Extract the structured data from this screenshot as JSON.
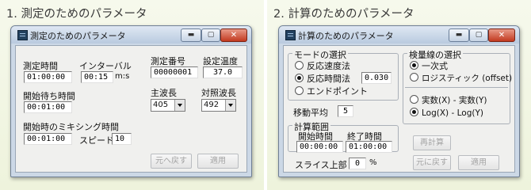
{
  "left": {
    "heading": "1. 測定のためのパラメータ",
    "window_title": "測定のためのパラメータ",
    "controls": {
      "minimize": "▬",
      "maximize": "▢",
      "close": "✕"
    },
    "measure_time": {
      "label": "測定時間",
      "value": "01:00:00"
    },
    "interval": {
      "label": "インターバル",
      "value": "00:15",
      "unit": "m:s"
    },
    "wait_time": {
      "label": "開始待ち時間",
      "value": "00:01:00"
    },
    "mixing": {
      "label": "開始時のミキシング時間",
      "value": "00:01:00",
      "speed_label": "スピード",
      "speed_value": "10"
    },
    "measure_no": {
      "label": "測定番号",
      "value": "00000001"
    },
    "temp": {
      "label": "設定温度",
      "value": "37.0"
    },
    "main_wave": {
      "label": "主波長",
      "value": "405"
    },
    "ref_wave": {
      "label": "対照波長",
      "value": "492"
    },
    "buttons": {
      "back": "元へ戻す",
      "apply": "適用"
    }
  },
  "right": {
    "heading": "2. 計算のためのパラメータ",
    "window_title": "計算のためのパラメータ",
    "controls": {
      "minimize": "▬",
      "maximize": "▢",
      "close": "✕"
    },
    "mode": {
      "title": "モードの選択",
      "options": [
        "反応速度法",
        "反応時間法",
        "エンドポイント"
      ],
      "selected": "反応時間法",
      "reaction_time_value": "0.030"
    },
    "moving_avg": {
      "label": "移動平均",
      "value": "5"
    },
    "calc_range": {
      "title": "計算範囲",
      "start_label": "開始時間",
      "start_value": "00:00:00",
      "end_label": "終了時間",
      "end_value": "01:00:00"
    },
    "slice": {
      "label": "スライス上部",
      "value": "0",
      "unit": "%"
    },
    "calibration": {
      "title": "検量線の選択",
      "options": [
        "一次式",
        "ロジスティック (offset)"
      ],
      "selected": "一次式"
    },
    "scale": {
      "options": [
        "実数(X) - 実数(Y)",
        "Log(X) - Log(Y)"
      ],
      "selected": "Log(X) - Log(Y)"
    },
    "buttons": {
      "recalc": "再計算",
      "back": "元に戻す",
      "apply": "適用"
    }
  }
}
